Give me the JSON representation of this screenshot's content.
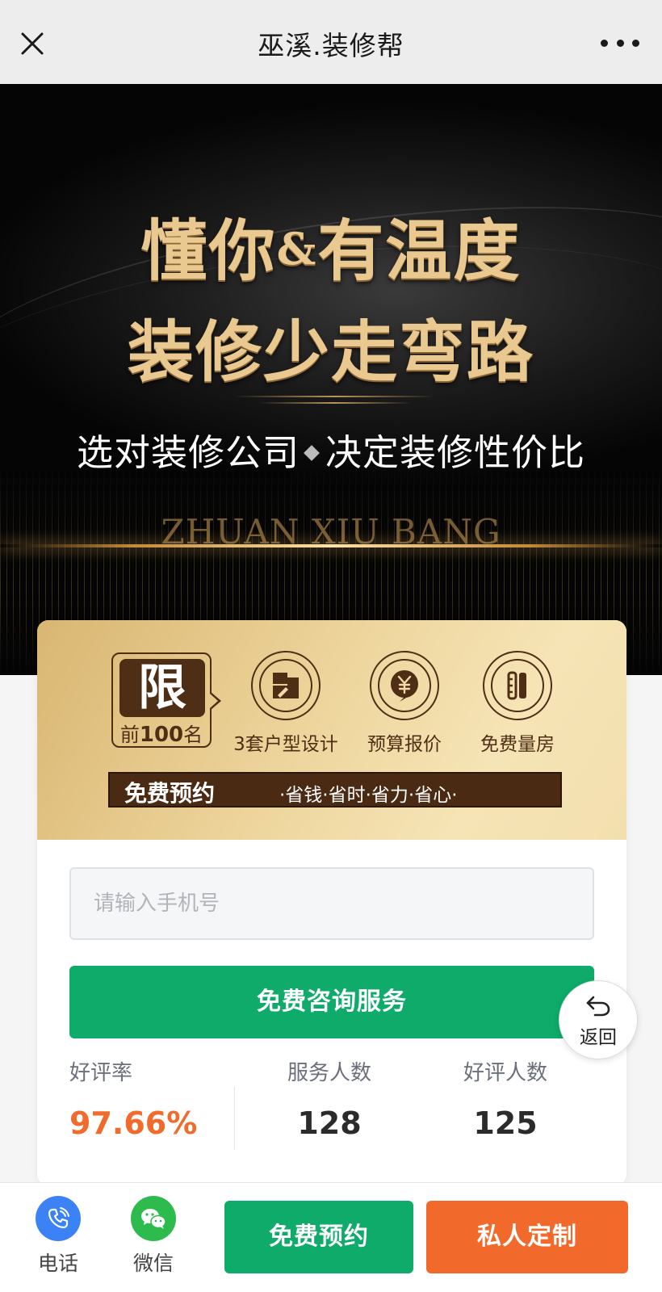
{
  "topbar": {
    "title": "巫溪.装修帮"
  },
  "hero": {
    "line1_a": "懂你",
    "line1_amp": "&",
    "line1_b": "有温度",
    "line2": "装修少走弯路",
    "sub_a": "选对装修公司",
    "sub_b": "决定装修性价比",
    "brand": "ZHUAN XIU BANG"
  },
  "promo": {
    "limit_char": "限",
    "limit_prefix": "前",
    "limit_num": "100",
    "limit_suffix": "名",
    "features": [
      {
        "label": "3套户型设计",
        "icon": "floorplan-icon"
      },
      {
        "label": "预算报价",
        "icon": "yuan-icon"
      },
      {
        "label": "免费量房",
        "icon": "ruler-icon"
      }
    ],
    "bar_left": "免费预约",
    "bar_right": "·省钱·省时·省力·省心·"
  },
  "form": {
    "phone_placeholder": "请输入手机号",
    "consult_label": "免费咨询服务"
  },
  "stats": [
    {
      "label": "好评率",
      "value": "97.66%"
    },
    {
      "label": "服务人数",
      "value": "128"
    },
    {
      "label": "好评人数",
      "value": "125"
    }
  ],
  "back_label": "返回",
  "bottom": {
    "phone_label": "电话",
    "wechat_label": "微信",
    "book_label": "免费预约",
    "custom_label": "私人定制"
  },
  "colors": {
    "primary_green": "#0eab6a",
    "accent_orange": "#f26a2b",
    "rate_orange": "#f06b2c",
    "gold_dark": "#4e2e14"
  }
}
